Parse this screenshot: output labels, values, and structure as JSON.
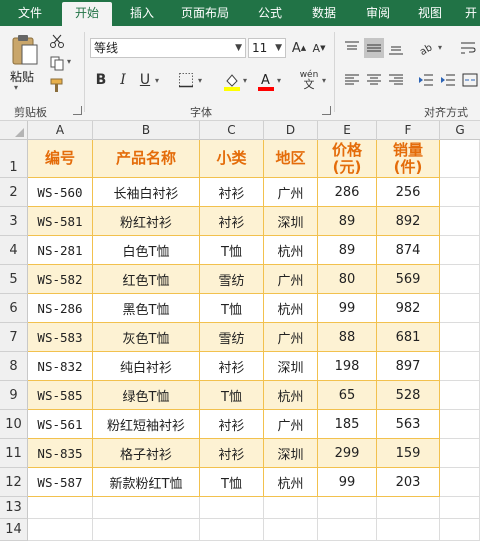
{
  "tabs": [
    "文件",
    "开始",
    "插入",
    "页面布局",
    "公式",
    "数据",
    "审阅",
    "视图",
    "开"
  ],
  "ribbon": {
    "clipboard": {
      "paste_label": "粘贴",
      "group_label": "剪贴板"
    },
    "font": {
      "font_name": "等线",
      "font_size": "11",
      "bold": "B",
      "italic": "I",
      "underline": "U",
      "phonetic": "wén",
      "group_label": "字体",
      "fill_color": "#ffff00",
      "font_color": "#ff0000"
    },
    "align": {
      "group_label": "对齐方式"
    }
  },
  "columns": [
    "A",
    "B",
    "C",
    "D",
    "E",
    "F",
    "G"
  ],
  "rows": [
    "1",
    "2",
    "3",
    "4",
    "5",
    "6",
    "7",
    "8",
    "9",
    "10",
    "11",
    "12",
    "13",
    "14"
  ],
  "headers": {
    "id": "编号",
    "name": "产品名称",
    "category": "小类",
    "region": "地区",
    "price_l1": "价格",
    "price_l2": "(元)",
    "sales_l1": "销量",
    "sales_l2": "(件)"
  },
  "table": [
    [
      "WS-560",
      "长袖白衬衫",
      "衬衫",
      "广州",
      "286",
      "256"
    ],
    [
      "WS-581",
      "粉红衬衫",
      "衬衫",
      "深圳",
      "89",
      "892"
    ],
    [
      "NS-281",
      "白色T恤",
      "T恤",
      "杭州",
      "89",
      "874"
    ],
    [
      "WS-582",
      "红色T恤",
      "雪纺",
      "广州",
      "80",
      "569"
    ],
    [
      "NS-286",
      "黑色T恤",
      "T恤",
      "杭州",
      "99",
      "982"
    ],
    [
      "WS-583",
      "灰色T恤",
      "雪纺",
      "广州",
      "88",
      "681"
    ],
    [
      "NS-832",
      "纯白衬衫",
      "衬衫",
      "深圳",
      "198",
      "897"
    ],
    [
      "WS-585",
      "绿色T恤",
      "T恤",
      "杭州",
      "65",
      "528"
    ],
    [
      "WS-561",
      "粉红短袖衬衫",
      "衬衫",
      "广州",
      "185",
      "563"
    ],
    [
      "NS-835",
      "格子衬衫",
      "衬衫",
      "深圳",
      "299",
      "159"
    ],
    [
      "WS-587",
      "新款粉红T恤",
      "T恤",
      "杭州",
      "99",
      "203"
    ]
  ],
  "colors": {
    "accent": "#217346",
    "header_text": "#e46c0a",
    "band": "#fdf2d3",
    "border": "#f2c14e"
  }
}
